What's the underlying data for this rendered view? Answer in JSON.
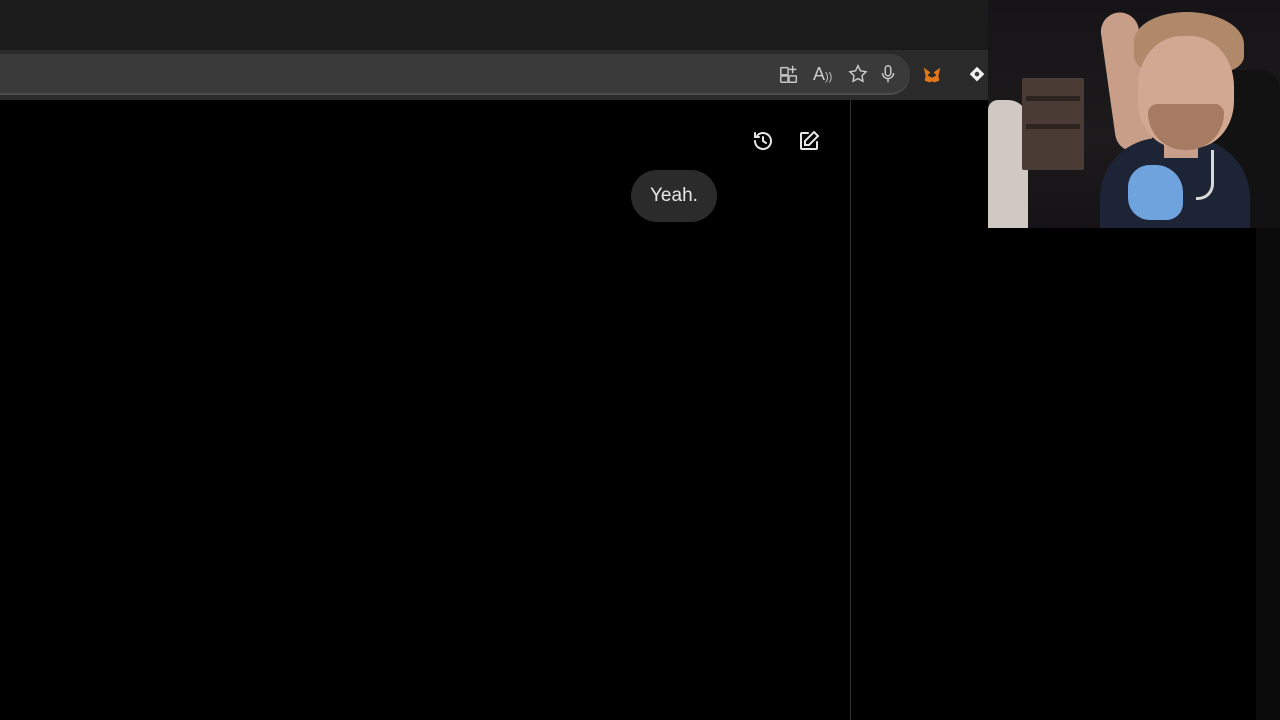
{
  "browser": {
    "toolbar_icons": [
      "app-available-icon",
      "read-aloud-icon",
      "favorite-star-icon",
      "microphone-icon"
    ],
    "read_aloud_label": "A",
    "extensions": [
      "metamask-fox-icon",
      "extension-icon"
    ]
  },
  "chat": {
    "actions": [
      "history-icon",
      "new-chat-icon"
    ],
    "messages": [
      {
        "role": "user",
        "text": "Yeah."
      }
    ]
  },
  "colors": {
    "background": "#000000",
    "toolbar": "#2a2a2a",
    "bubble": "#2b2b2b",
    "text": "#e8e8e8"
  }
}
